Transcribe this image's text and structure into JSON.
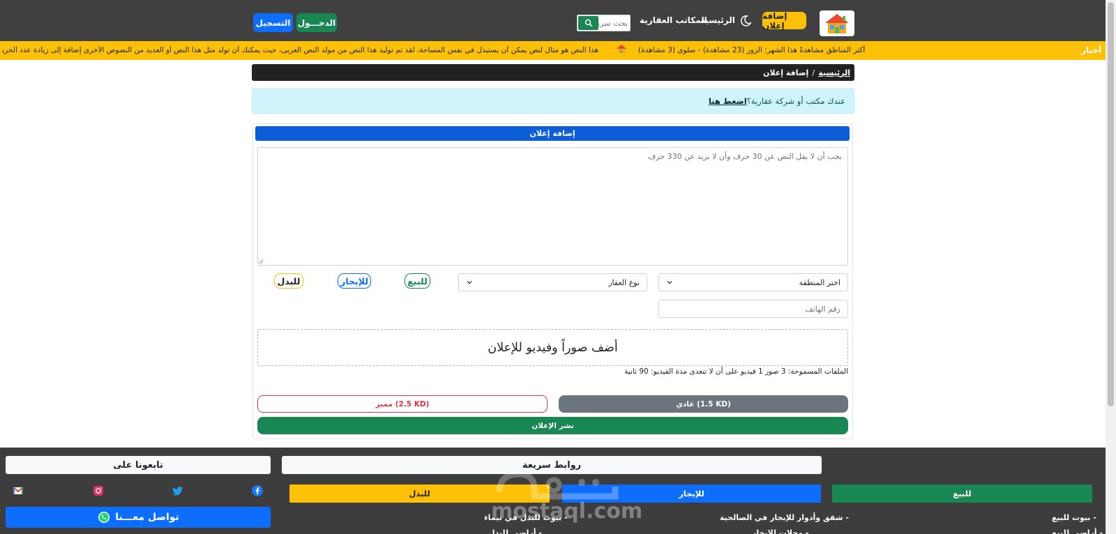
{
  "navbar": {
    "add_ad_label": "إضافة إعلان",
    "home_label": "الرئيسية",
    "offices_label": "المكاتب العقارية",
    "search_placeholder": "بحث سريع",
    "login_label": "الدخـــول",
    "register_label": "التسجيل"
  },
  "ticker": {
    "label": "أخبار",
    "item1": "أكثر المناطق مشاهدةً هذا الشهر: الزور (23 مشاهدة) - سلوى (3 مشاهدة)",
    "item2": "هذا النص هو مثال لنص يمكن أن يستبدل في نفس المساحة، لقد تم توليد هذا النص من مولد النص العربى، حيث يمكنك أن تولد مثل هذا النص أو العديد من النصوص الأخرى إضافة إلى زيادة عدد الحروف"
  },
  "breadcrumb": {
    "home": "الرئيسية",
    "separator": "/",
    "current": "إضافة إعلان"
  },
  "alert": {
    "text": "عندك مكتب أو شركة عقارية؟",
    "link": "اضغط هنا"
  },
  "form": {
    "header": "إضافة إعلان",
    "textarea_placeholder": "يجب أن لا يقل النص عن 30 حرف وأن لا يزيد عن 330 حرف",
    "region_select": "اختر المنطقة",
    "property_type_select": "نوع العقار",
    "for_sale": "للبيع",
    "for_rent": "للإيجار",
    "for_exchange": "للبدل",
    "phone_placeholder": "رقم الهاتف",
    "upload_label": "أضف صوراً وفيديو للإعلان",
    "files_note": "الملفات المسموحة: 3 صور 1 فيديو على أن لا تتعدى مدة الفيديو: 90 ثانية",
    "regular_price": "عادي (1.5 KD)",
    "featured_price": "مميز (2.5 KD)",
    "publish": "نشر الإعلان"
  },
  "footer": {
    "quick_links": "روابط سريعة",
    "follow_us": "تابعونا على",
    "tab_sale": "للبيع",
    "tab_rent": "للإيجار",
    "tab_exchange": "للبدل",
    "link_sale": "- بيوت للبيع",
    "link_rent": "- شقق وأدوار للإيجار في الصالحية",
    "link_exchange": "- بيوت للبدل في تيماء",
    "link_sale_2": "- أراضي للبيع",
    "link_rent_2": "- محلات للإيجار",
    "link_exchange_2": "- أراضي للبدل",
    "contact": "تواصل معـــنا",
    "watermark": "mostaql.com"
  },
  "colors": {
    "navbar": "#404040",
    "ticker": "#ffc107",
    "primary": "#0d6efd",
    "success": "#198754",
    "danger": "#dc3545"
  }
}
